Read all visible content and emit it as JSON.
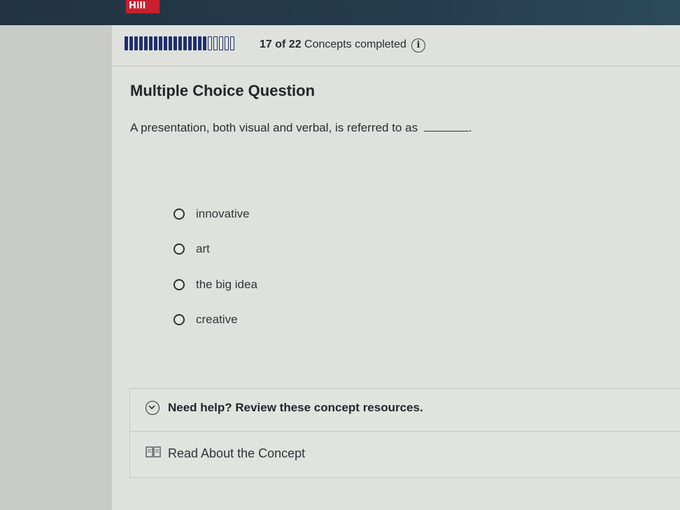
{
  "header": {
    "logo_text": "Hill"
  },
  "progress": {
    "completed": 17,
    "total": 22,
    "count_text": "17 of 22",
    "label": "Concepts completed",
    "info_icon": "info-icon"
  },
  "question": {
    "title": "Multiple Choice Question",
    "prompt": "A presentation, both visual and verbal, is referred to as",
    "prompt_end": ".",
    "options": [
      {
        "label": "innovative"
      },
      {
        "label": "art"
      },
      {
        "label": "the big idea"
      },
      {
        "label": "creative"
      }
    ]
  },
  "help": {
    "header": "Need help? Review these concept resources.",
    "chevron_icon": "chevron-down-icon",
    "resource_label": "Read About the Concept",
    "resource_icon": "book-icon"
  },
  "colors": {
    "progress_fill": "#1e2f6d",
    "brand_red": "#c8202f",
    "topbar": "#213342"
  }
}
